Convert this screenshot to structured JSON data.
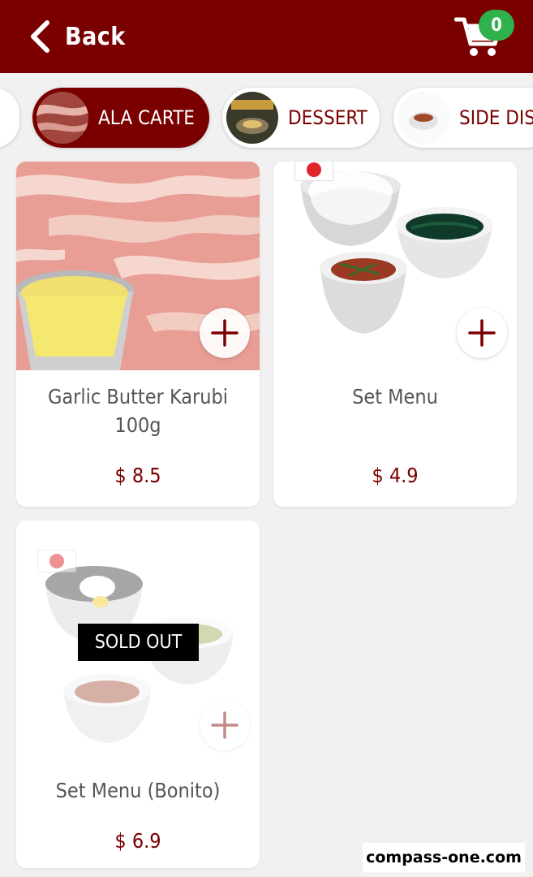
{
  "header": {
    "back_label": "Back",
    "cart_count": "0"
  },
  "categories": [
    {
      "label": ""
    },
    {
      "label": "ALA CARTE",
      "active": true
    },
    {
      "label": "DESSERT"
    },
    {
      "label": "SIDE DISH"
    }
  ],
  "products": [
    {
      "name": "Garlic Butter Karubi 100g",
      "price": "$ 8.5"
    },
    {
      "name": "Set Menu",
      "price": "$ 4.9"
    },
    {
      "name": "Set Menu (Bonito)",
      "price": "$ 6.9",
      "status": "SOLD OUT"
    }
  ],
  "watermark": "compass-one.com",
  "colors": {
    "brand": "#7a0000",
    "badge": "#2fb24b",
    "background": "#f1f1f1"
  },
  "icons": [
    "chevron-left-icon",
    "cart-icon",
    "plus-icon",
    "japan-flag-icon"
  ]
}
